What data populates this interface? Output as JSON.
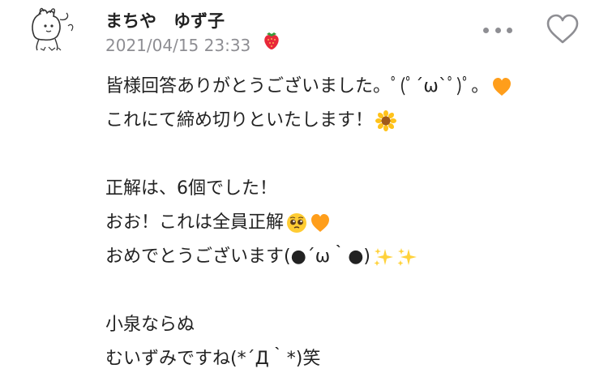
{
  "post": {
    "author": "まちや　ゆず子",
    "author_emoji": "strawberry-icon",
    "timestamp": "2021/04/15 23:33",
    "lines": [
      "皆様回答ありがとうございました。ﾟ(ﾟ´ω`ﾟ)ﾟ。",
      "これにて締め切りといたします！",
      "",
      "正解は、6個でした！",
      "おお！これは全員正解",
      "おめでとうございます(●´ω｀●)",
      "",
      "小泉ならぬ",
      "むいずみですね(*´Д｀*)笑"
    ],
    "line_emojis": [
      [
        "orange-heart-icon"
      ],
      [
        "sunflower-icon"
      ],
      [],
      [],
      [
        "pleading-face-icon",
        "orange-heart-icon"
      ],
      [
        "sparkles-icon",
        "sparkles-icon"
      ],
      [],
      [],
      []
    ]
  },
  "colors": {
    "text": "#222222",
    "timestamp": "#8e8e93",
    "icon_gray": "#8e8e93",
    "orange_heart": "#ff9e1b",
    "sparkle": "#ffd23c"
  },
  "actions": {
    "more_icon": "more-dots-icon",
    "like_icon": "heart-outline-icon"
  }
}
